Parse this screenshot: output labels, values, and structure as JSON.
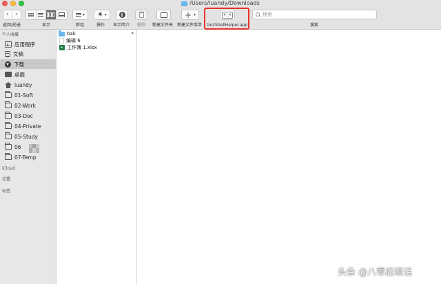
{
  "window": {
    "title": "/Users/luandy/Downloads"
  },
  "toolbar": {
    "labels": {
      "back_forward": "返回/前进",
      "view": "显示",
      "group": "群组",
      "action": "操作",
      "get_info": "显示简介",
      "delete": "删除",
      "new_folder": "新建文件夹",
      "new_file_menu": "新建文件菜单",
      "go2shell": "Go2ShellHelper.app",
      "search": "搜索"
    },
    "go2shell_glyph": ">_<",
    "search": {
      "placeholder": "搜索",
      "value": ""
    },
    "highlight_color": "#e8312a"
  },
  "sidebar": {
    "favorites_header": "个人收藏",
    "items": [
      {
        "label": "应用程序",
        "icon": "apps-icon",
        "selected": false
      },
      {
        "label": "文稿",
        "icon": "document-icon",
        "selected": false
      },
      {
        "label": "下载",
        "icon": "download-icon",
        "selected": true
      },
      {
        "label": "桌面",
        "icon": "desktop-icon",
        "selected": false
      },
      {
        "label": "luandy",
        "icon": "home-icon",
        "selected": false
      },
      {
        "label": "01-Soft",
        "icon": "folder-icon",
        "selected": false
      },
      {
        "label": "02-Work",
        "icon": "folder-icon",
        "selected": false
      },
      {
        "label": "03-Doc",
        "icon": "folder-icon",
        "selected": false
      },
      {
        "label": "04-Private",
        "icon": "folder-icon",
        "selected": false
      },
      {
        "label": "05-Study",
        "icon": "folder-icon",
        "selected": false
      },
      {
        "label": "06",
        "icon": "folder-icon",
        "selected": false
      },
      {
        "label": "07-Temp",
        "icon": "folder-icon",
        "selected": false
      }
    ],
    "icloud_header": "iCloud",
    "locations_header": "位置",
    "tags_header": "标签"
  },
  "files": [
    {
      "name": "bak",
      "type": "folder",
      "has_children": true
    },
    {
      "name": "编辑 6",
      "type": "file"
    },
    {
      "name": "工作簿 1.xlsx",
      "type": "xlsx"
    }
  ],
  "watermark": "头条 @八零后琐话"
}
